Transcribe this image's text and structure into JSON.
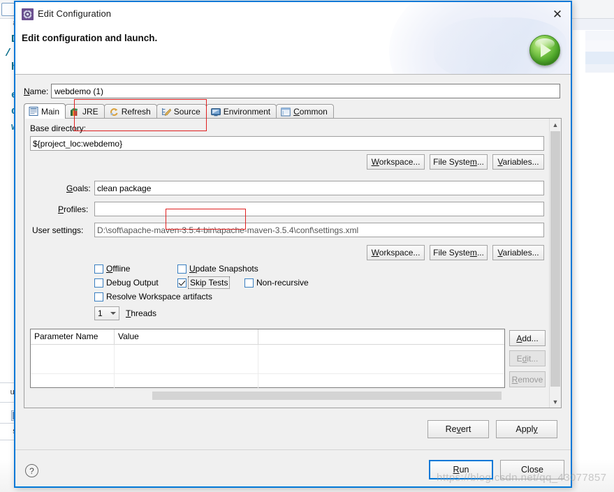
{
  "background": {
    "editor_tab_label": "ava",
    "code_lines": [
      "DO",
      "- /",
      "ht",
      "eb",
      "<d",
      "we"
    ],
    "bottom_left_labels": [
      "urce",
      "s to"
    ]
  },
  "dialog": {
    "title": "Edit Configuration",
    "title_icon": "gear-icon",
    "close_label": "✕",
    "subtitle": "Edit configuration and launch.",
    "run_orb_icon": "run-play-icon"
  },
  "name_field": {
    "label": "Name:",
    "label_mnemonic": "N",
    "value": "webdemo (1)"
  },
  "tabs": [
    {
      "label": "Main",
      "icon": "main-page-icon",
      "active": true
    },
    {
      "label": "JRE",
      "icon": "jre-books-icon",
      "active": false
    },
    {
      "label": "Refresh",
      "icon": "refresh-arrows-icon",
      "active": false
    },
    {
      "label": "Source",
      "icon": "source-pencil-icon",
      "active": false
    },
    {
      "label": "Environment",
      "icon": "environment-monitor-icon",
      "active": false
    },
    {
      "label": "Common",
      "icon": "common-window-icon",
      "active": false
    }
  ],
  "main_tab": {
    "base_directory": {
      "label": "Base directory:",
      "value": "${project_loc:webdemo}"
    },
    "path_buttons": [
      {
        "label": "Workspace...",
        "name": "workspace-button"
      },
      {
        "label": "File System...",
        "name": "file-system-button"
      },
      {
        "label": "Variables...",
        "name": "variables-button"
      }
    ],
    "goals": {
      "label": "Goals:",
      "value": "clean package"
    },
    "profiles": {
      "label": "Profiles:",
      "value": ""
    },
    "user_settings": {
      "label": "User settings:",
      "value": "D:\\soft\\apache-maven-3.5.4-bin\\apache-maven-3.5.4\\conf\\settings.xml"
    },
    "settings_buttons": [
      {
        "label": "Workspace...",
        "name": "settings-workspace-button"
      },
      {
        "label": "File System...",
        "name": "settings-file-system-button"
      },
      {
        "label": "Variables...",
        "name": "settings-variables-button"
      }
    ],
    "checkboxes": [
      {
        "label": "Offline",
        "checked": false,
        "name": "offline-checkbox"
      },
      {
        "label": "Update Snapshots",
        "checked": false,
        "name": "update-snapshots-checkbox"
      },
      {
        "label": "Debug Output",
        "checked": false,
        "name": "debug-output-checkbox"
      },
      {
        "label": "Skip Tests",
        "checked": true,
        "name": "skip-tests-checkbox"
      },
      {
        "label": "Non-recursive",
        "checked": false,
        "name": "non-recursive-checkbox"
      },
      {
        "label": "Resolve Workspace artifacts",
        "checked": false,
        "name": "resolve-workspace-artifacts-checkbox"
      }
    ],
    "threads": {
      "value": "1",
      "label": "Threads"
    },
    "parameter_table": {
      "columns": [
        "Parameter Name",
        "Value",
        ""
      ],
      "rows": [],
      "empty_row_count": 3
    },
    "table_buttons": [
      {
        "label": "Add...",
        "enabled": true,
        "name": "add-parameter-button"
      },
      {
        "label": "Edit...",
        "enabled": false,
        "name": "edit-parameter-button"
      },
      {
        "label": "Remove",
        "enabled": false,
        "name": "remove-parameter-button"
      }
    ]
  },
  "footer": {
    "revert": "Revert",
    "apply": "Apply",
    "run": "Run",
    "close": "Close",
    "help_icon": "?"
  },
  "watermark": "https://blog.csdn.net/qq_43077857",
  "colors": {
    "dialog_border": "#0078d7",
    "annotation": "#e02020",
    "run_green": "#4fa82a",
    "checkbox_border": "#3a7fc1"
  }
}
